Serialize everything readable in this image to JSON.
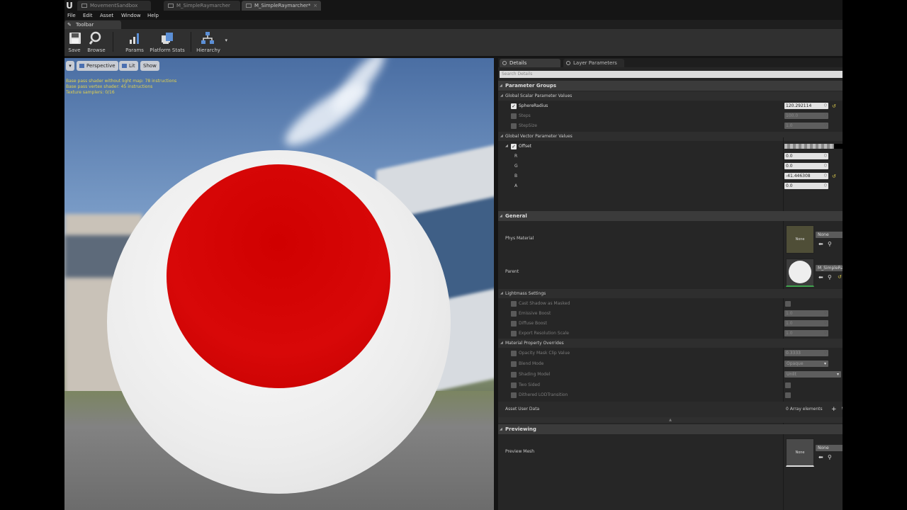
{
  "tabs": [
    {
      "label": "MovementSandbox",
      "active": false
    },
    {
      "label": "M_SimpleRaymarcher",
      "active": false
    },
    {
      "label": "M_SimpleRaymarcher*",
      "active": true
    }
  ],
  "menu": [
    "File",
    "Edit",
    "Asset",
    "Window",
    "Help"
  ],
  "toolbar_panel": {
    "title": "Toolbar"
  },
  "toolbar": {
    "save": "Save",
    "browse": "Browse",
    "params": "Params",
    "platform_stats": "Platform Stats",
    "hierarchy": "Hierarchy"
  },
  "viewport": {
    "perspective": "Perspective",
    "lit": "Lit",
    "show": "Show",
    "stats": [
      "Base pass shader without light map: 78 instructions",
      "Base pass vertex shader: 45 instructions",
      "Texture samplers: 0/16"
    ]
  },
  "details": {
    "tab_details": "Details",
    "tab_layer": "Layer Parameters",
    "search_placeholder": "Search Details",
    "parameter_groups": "Parameter Groups",
    "scalar_group": "Global Scalar Parameter Values",
    "scalars": [
      {
        "name": "SphereRadius",
        "value": "120.292114",
        "enabled": true
      },
      {
        "name": "Steps",
        "value": "100.0",
        "enabled": false
      },
      {
        "name": "StepSize",
        "value": "1.0",
        "enabled": false
      }
    ],
    "vector_group": "Global Vector Parameter Values",
    "vector": {
      "name": "Offset",
      "components": [
        {
          "name": "R",
          "value": "0.0"
        },
        {
          "name": "G",
          "value": "0.0"
        },
        {
          "name": "B",
          "value": "-41.446308"
        },
        {
          "name": "A",
          "value": "0.0"
        }
      ]
    },
    "general": "General",
    "phys_material": "Phys Material",
    "phys_value": "None",
    "phys_thumb": "None",
    "parent": "Parent",
    "parent_value": "M_SimpleRaymarcher",
    "lightmass": "Lightmass Settings",
    "lightmass_items": [
      {
        "name": "Cast Shadow as Masked",
        "value": ""
      },
      {
        "name": "Emissive Boost",
        "value": "1.0"
      },
      {
        "name": "Diffuse Boost",
        "value": "1.0"
      },
      {
        "name": "Export Resolution Scale",
        "value": "1.0"
      }
    ],
    "overrides": "Material Property Overrides",
    "opacity_mask": "Opacity Mask Clip Value",
    "opacity_value": "0.3333",
    "blend_mode": "Blend Mode",
    "blend_value": "Opaque",
    "shading_model": "Shading Model",
    "shading_value": "Unlit",
    "two_sided": "Two Sided",
    "dithered": "Dithered LODTransition",
    "asset_user_data": "Asset User Data",
    "array_elements": "0 Array elements",
    "previewing": "Previewing",
    "preview_mesh": "Preview Mesh",
    "preview_value": "None",
    "preview_thumb": "None"
  },
  "colors": {
    "accent_reset": "#d9c84a",
    "sphere_red": "#d00000"
  }
}
